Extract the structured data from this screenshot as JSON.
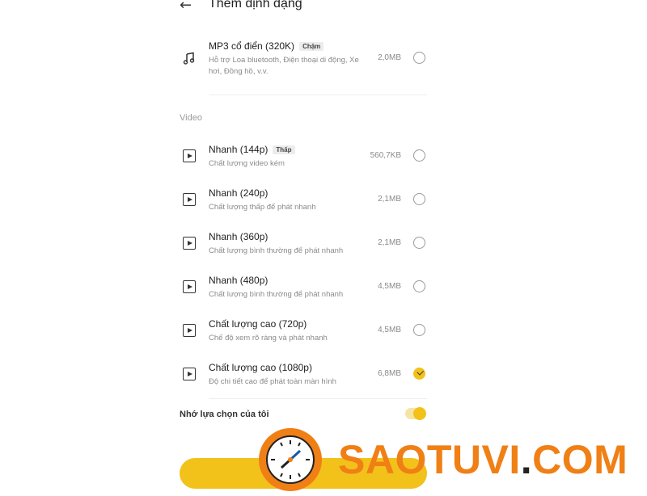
{
  "header": {
    "back_icon": "arrow-left-icon",
    "title": "Thêm định dạng"
  },
  "audio_items": [
    {
      "icon": "music-note-icon",
      "name": "MP3 cổ điển (320K)",
      "badge": "Chậm",
      "desc": "Hỗ trợ Loa bluetooth, Điện thoại di động, Xe hơi, Đồng hồ, v.v.",
      "size": "2,0MB",
      "selected": false
    }
  ],
  "video_section": {
    "label": "Video"
  },
  "video_items": [
    {
      "icon": "play-box-icon",
      "name": "Nhanh (144p)",
      "badge": "Thấp",
      "desc": "Chất lượng video kém",
      "size": "560,7KB",
      "selected": false
    },
    {
      "icon": "play-box-icon",
      "name": "Nhanh (240p)",
      "badge": "",
      "desc": "Chất lượng thấp để phát nhanh",
      "size": "2,1MB",
      "selected": false
    },
    {
      "icon": "play-box-icon",
      "name": "Nhanh (360p)",
      "badge": "",
      "desc": "Chất lượng bình thường để phát nhanh",
      "size": "2,1MB",
      "selected": false
    },
    {
      "icon": "play-box-icon",
      "name": "Nhanh (480p)",
      "badge": "",
      "desc": "Chất lượng bình thường để phát nhanh",
      "size": "4,5MB",
      "selected": false
    },
    {
      "icon": "play-box-icon",
      "name": "Chất lượng cao (720p)",
      "badge": "",
      "desc": "Chế độ xem rõ ràng và phát nhanh",
      "size": "4,5MB",
      "selected": false
    },
    {
      "icon": "play-box-icon",
      "name": "Chất lượng cao (1080p)",
      "badge": "",
      "desc": "Độ chi tiết cao để phát toàn màn hình",
      "size": "6,8MB",
      "selected": true
    }
  ],
  "remember": {
    "label": "Nhớ lựa chọn của tôi",
    "enabled": true
  },
  "watermark": {
    "brand": "SAOTUVI",
    "dot": ".",
    "tld": "COM",
    "icon": "clock-logo-icon"
  },
  "colors": {
    "accent": "#f2c21b",
    "watermark": "#f07f15"
  }
}
